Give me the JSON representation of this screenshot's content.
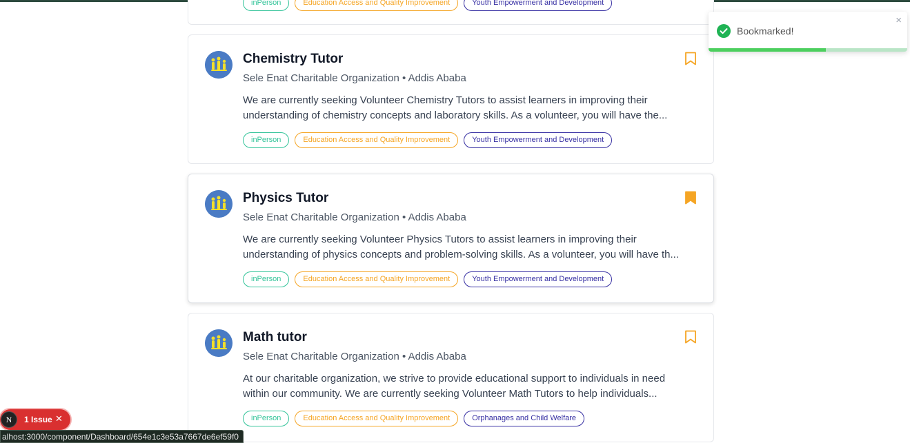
{
  "toast": {
    "message": "Bookmarked!",
    "close_label": "×",
    "progress": 0.59
  },
  "partial_card": {
    "tags": [
      "inPerson",
      "Education Access and Quality Improvement",
      "Youth Empowerment and Development"
    ]
  },
  "cards": [
    {
      "title": "Chemistry Tutor",
      "org": "Sele Enat Charitable Organization • Addis Ababa",
      "desc_line1": "We are currently seeking Volunteer Chemistry Tutors to assist learners in improving their",
      "desc_line2": "understanding of chemistry concepts and laboratory skills. As a volunteer, you will have the...",
      "tags": [
        "inPerson",
        "Education Access and Quality Improvement",
        "Youth Empowerment and Development"
      ],
      "bookmarked": false
    },
    {
      "title": "Physics Tutor",
      "org": "Sele Enat Charitable Organization • Addis Ababa",
      "desc_line1": "We are currently seeking Volunteer Physics Tutors to assist learners in improving their",
      "desc_line2": "understanding of physics concepts and problem-solving skills. As a volunteer, you will have th...",
      "tags": [
        "inPerson",
        "Education Access and Quality Improvement",
        "Youth Empowerment and Development"
      ],
      "bookmarked": true
    },
    {
      "title": "Math tutor",
      "org": "Sele Enat Charitable Organization • Addis Ababa",
      "desc_line1": "At our charitable organization, we strive to provide educational support to individuals in need",
      "desc_line2": "within our community. We are currently seeking Volunteer Math Tutors to help individuals...",
      "tags": [
        "inPerson",
        "Education Access and Quality Improvement",
        "Orphanages and Child Welfare"
      ],
      "bookmarked": false
    }
  ],
  "dev_indicator": {
    "letter": "N",
    "label": "1 Issue",
    "close": "✕"
  },
  "status_url": "alhost:3000/component/Dashboard/654e1c3e53a7667de6ef59f0",
  "colors": {
    "bookmark": "#f5a524",
    "tag_green": "#34c49a",
    "tag_orange": "#f5a524",
    "tag_indigo": "#3730a3",
    "logo_bg": "#4a7bc4",
    "logo_figures": "#f3df2a"
  }
}
